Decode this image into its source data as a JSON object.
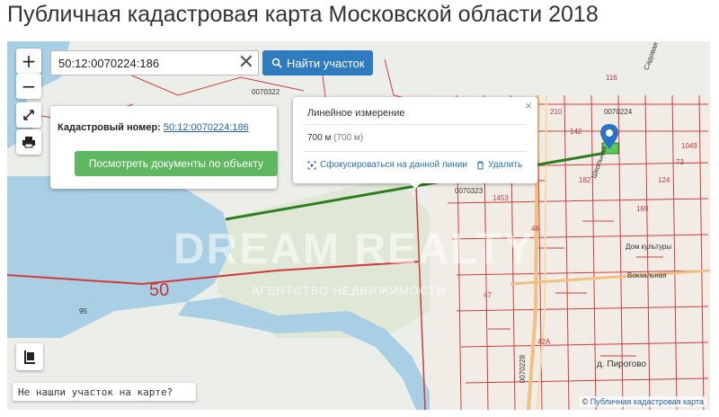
{
  "page_title": "Публичная кадастровая карта Московской области 2018",
  "controls": {
    "zoom_in": "+",
    "zoom_out": "−"
  },
  "search": {
    "value": "50:12:0070224:186",
    "clear_label": "✕",
    "find_button": "Найти участок"
  },
  "parcel_popup": {
    "label": "Кадастровый номер:",
    "cadastral_number": "50:12:0070224:186",
    "docs_button": "Посмотреть документы по объекту"
  },
  "measure_popup": {
    "title": "Линейное измерение",
    "distance": "700 м",
    "distance_detail": "(700 м)",
    "focus_link": "Сфокусироваться на данной линии",
    "delete_link": "Удалить",
    "close": "×"
  },
  "not_found_link": "Не нашли участок на карте?",
  "attribution": {
    "prefix": "©",
    "link": "Публичная кадастровая карта"
  },
  "watermark": {
    "text": "DREAM REALTY",
    "sub": "АГЕНТСТВО НЕДВИЖИМОСТИ"
  },
  "map_labels": {
    "block_1": "0070322",
    "block_2": "0070224",
    "block_3": "0070323",
    "block_4": "0070228",
    "road_50": "50",
    "street_sadovaya": "Садовая",
    "street_shkolnaya": "Школьная",
    "street_vokzalnaya": "Вокзальная",
    "culture_house": "Дом культуры",
    "village": "д. Пирогово",
    "n_95": "95",
    "n_116": "116",
    "n_210": "210",
    "n_142": "142",
    "n_1049": "1049",
    "n_1453": "1453",
    "n_42a": "42А",
    "n_47": "47",
    "n_46": "46",
    "n_182": "182",
    "n_73": "73",
    "n_124": "124",
    "n_169": "169"
  },
  "colors": {
    "accent": "#2f7bbf",
    "docs_button": "#5fb85f",
    "measure_line": "#2e7d1f",
    "cadastral_lines": "#d33b3b",
    "water": "#a8cfe3",
    "marker": "#2b73c2"
  }
}
